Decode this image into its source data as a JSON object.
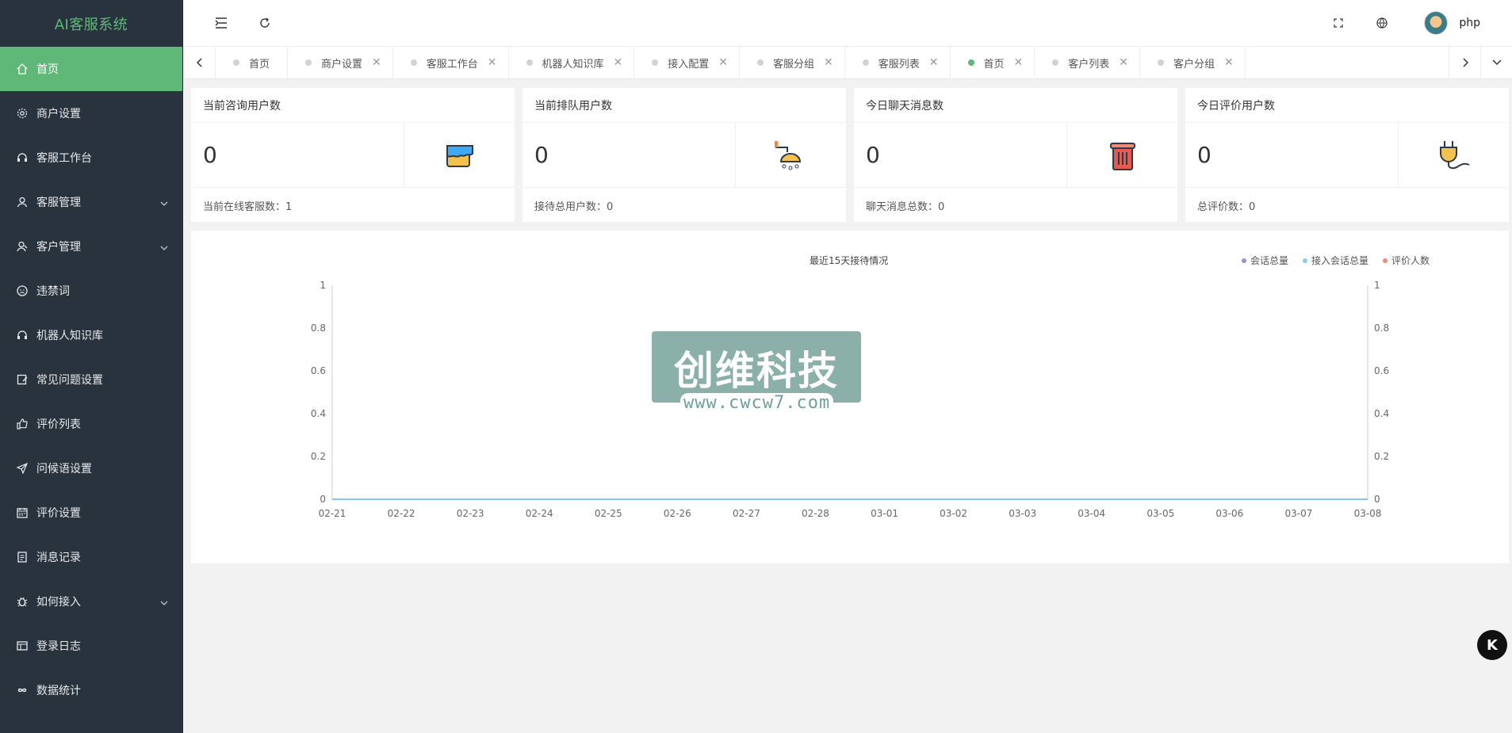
{
  "app": {
    "title": "AI客服系统"
  },
  "sidebar": {
    "items": [
      {
        "label": "首页",
        "icon": "home-icon",
        "active": true
      },
      {
        "label": "商户设置",
        "icon": "gear-icon"
      },
      {
        "label": "客服工作台",
        "icon": "headset-icon"
      },
      {
        "label": "客服管理",
        "icon": "user-icon",
        "expandable": true
      },
      {
        "label": "客户管理",
        "icon": "user-group-icon",
        "expandable": true
      },
      {
        "label": "违禁词",
        "icon": "face-icon"
      },
      {
        "label": "机器人知识库",
        "icon": "headset-icon"
      },
      {
        "label": "常见问题设置",
        "icon": "edit-icon"
      },
      {
        "label": "评价列表",
        "icon": "thumb-up-icon"
      },
      {
        "label": "问候语设置",
        "icon": "send-icon"
      },
      {
        "label": "评价设置",
        "icon": "calendar-icon"
      },
      {
        "label": "消息记录",
        "icon": "document-icon"
      },
      {
        "label": "如何接入",
        "icon": "bug-icon",
        "expandable": true
      },
      {
        "label": "登录日志",
        "icon": "table-icon"
      },
      {
        "label": "数据统计",
        "icon": "infinity-icon"
      }
    ]
  },
  "header": {
    "username": "php"
  },
  "tabs": [
    {
      "label": "首页",
      "closable": false,
      "active": false
    },
    {
      "label": "商户设置",
      "closable": true,
      "active": false
    },
    {
      "label": "客服工作台",
      "closable": true,
      "active": false
    },
    {
      "label": "机器人知识库",
      "closable": true,
      "active": false
    },
    {
      "label": "接入配置",
      "closable": true,
      "active": false
    },
    {
      "label": "客服分组",
      "closable": true,
      "active": false
    },
    {
      "label": "客服列表",
      "closable": true,
      "active": false
    },
    {
      "label": "首页",
      "closable": true,
      "active": true
    },
    {
      "label": "客户列表",
      "closable": true,
      "active": false
    },
    {
      "label": "客户分组",
      "closable": true,
      "active": false
    }
  ],
  "cards": [
    {
      "title": "当前咨询用户数",
      "value": "0",
      "footer": "当前在线客服数：1",
      "icon": "paint-bucket-icon"
    },
    {
      "title": "当前排队用户数",
      "value": "0",
      "footer": "接待总用户数：0",
      "icon": "shower-icon"
    },
    {
      "title": "今日聊天消息数",
      "value": "0",
      "footer": "聊天消息总数：0",
      "icon": "trash-can-icon"
    },
    {
      "title": "今日评价用户数",
      "value": "0",
      "footer": "总评价数：0",
      "icon": "plug-icon"
    }
  ],
  "chart_data": {
    "type": "line",
    "title": "最近15天接待情况",
    "categories": [
      "02-21",
      "02-22",
      "02-23",
      "02-24",
      "02-25",
      "02-26",
      "02-27",
      "02-28",
      "03-01",
      "03-02",
      "03-03",
      "03-04",
      "03-05",
      "03-06",
      "03-07",
      "03-08"
    ],
    "series": [
      {
        "name": "会话总量",
        "color": "#9a8fd8",
        "values": [
          0,
          0,
          0,
          0,
          0,
          0,
          0,
          0,
          0,
          0,
          0,
          0,
          0,
          0,
          0,
          0
        ]
      },
      {
        "name": "接入会话总量",
        "color": "#7fd0ef",
        "values": [
          0,
          0,
          0,
          0,
          0,
          0,
          0,
          0,
          0,
          0,
          0,
          0,
          0,
          0,
          0,
          0
        ]
      },
      {
        "name": "评价人数",
        "color": "#f08a78",
        "values": [
          0,
          0,
          0,
          0,
          0,
          0,
          0,
          0,
          0,
          0,
          0,
          0,
          0,
          0,
          0,
          0
        ]
      }
    ],
    "ylim": [
      0,
      1
    ],
    "yticks": [
      "0",
      "0.2",
      "0.4",
      "0.6",
      "0.8",
      "1"
    ],
    "legend": "top-right",
    "grid": false
  },
  "watermark": {
    "text": "创维科技",
    "url": "www.cwcw7.com"
  },
  "floating": {
    "label": "K"
  }
}
